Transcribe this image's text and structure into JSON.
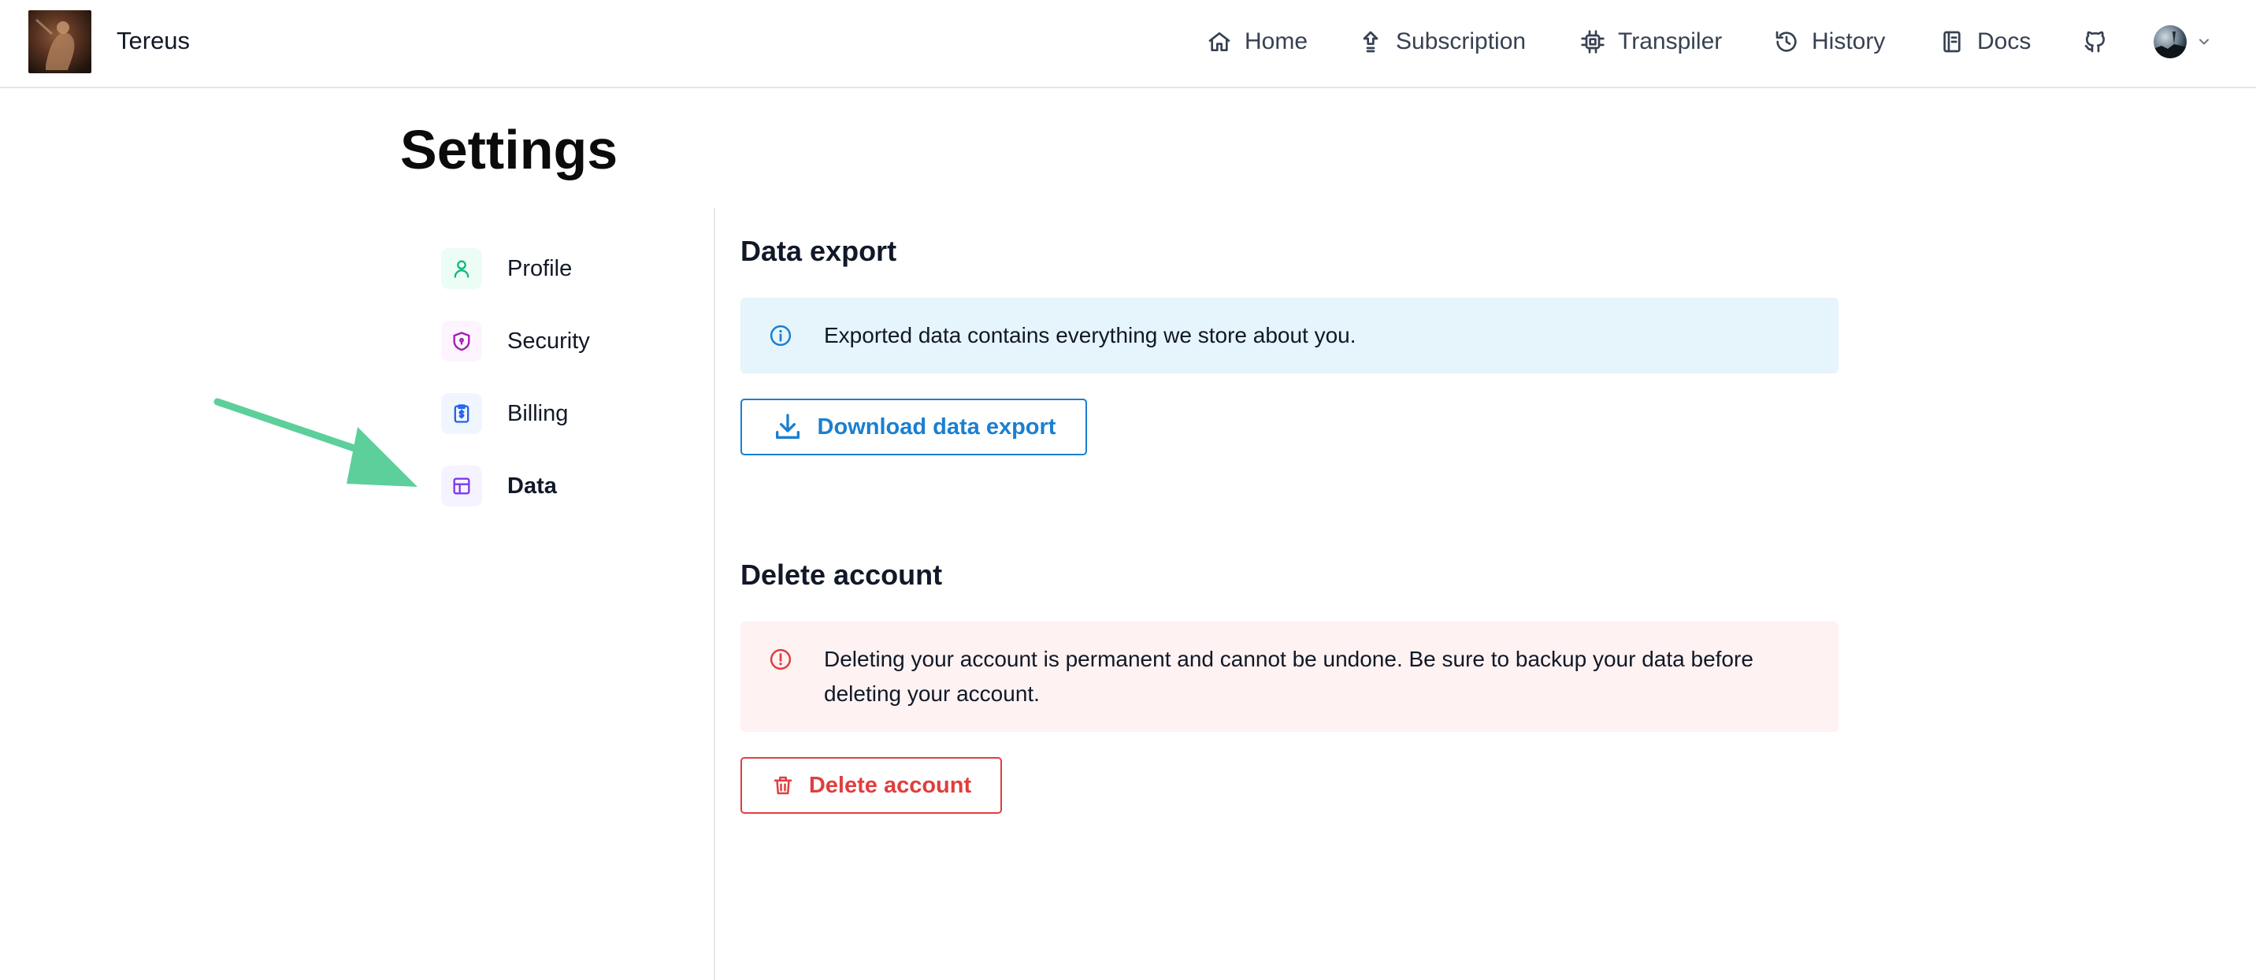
{
  "app": {
    "brand": "Tereus"
  },
  "nav": {
    "items": [
      {
        "label": "Home",
        "icon": "home-icon"
      },
      {
        "label": "Subscription",
        "icon": "upload-icon"
      },
      {
        "label": "Transpiler",
        "icon": "cpu-icon"
      },
      {
        "label": "History",
        "icon": "history-icon"
      },
      {
        "label": "Docs",
        "icon": "book-icon"
      }
    ],
    "github_icon": "github-icon",
    "user_menu_icon": "chevron-down-icon"
  },
  "page": {
    "title": "Settings"
  },
  "sidebar": {
    "items": [
      {
        "label": "Profile",
        "icon": "user-icon",
        "color": "#10b981",
        "bg": "#ecfdf5",
        "active": false
      },
      {
        "label": "Security",
        "icon": "shield-icon",
        "color": "#a21caf",
        "bg": "#fdf4ff",
        "active": false
      },
      {
        "label": "Billing",
        "icon": "billing-icon",
        "color": "#2563eb",
        "bg": "#eff6ff",
        "active": false
      },
      {
        "label": "Data",
        "icon": "table-icon",
        "color": "#7c3aed",
        "bg": "#f5f3ff",
        "active": true
      }
    ]
  },
  "data_export": {
    "title": "Data export",
    "info": "Exported data contains everything we store about you.",
    "button_label": "Download data export"
  },
  "delete_account": {
    "title": "Delete account",
    "warning": "Deleting your account is permanent and cannot be undone. Be sure to backup your data before deleting your account.",
    "button_label": "Delete account"
  },
  "colors": {
    "info_bg": "#e6f4fc",
    "info_accent": "#1a7fd0",
    "danger_bg": "#fef2f2",
    "danger_accent": "#e03e3e",
    "annotation_arrow": "#5ccf9a"
  }
}
